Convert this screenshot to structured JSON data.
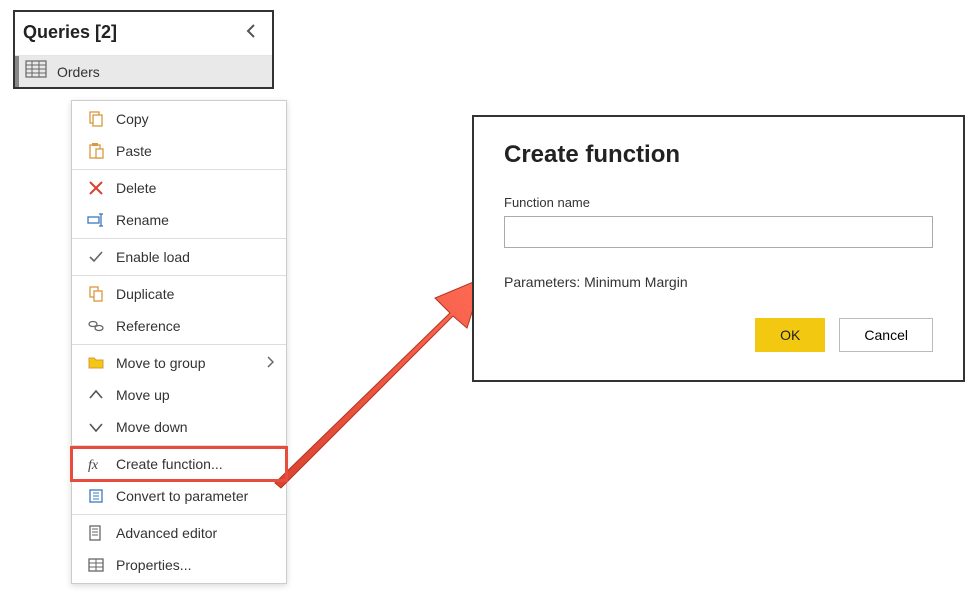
{
  "queries": {
    "title": "Queries [2]",
    "selected_query": "Orders"
  },
  "menu": {
    "copy": "Copy",
    "paste": "Paste",
    "delete": "Delete",
    "rename": "Rename",
    "enable_load": "Enable load",
    "duplicate": "Duplicate",
    "reference": "Reference",
    "move_to_group": "Move to group",
    "move_up": "Move up",
    "move_down": "Move down",
    "create_function": "Create function...",
    "convert_to_parameter": "Convert to parameter",
    "advanced_editor": "Advanced editor",
    "properties": "Properties..."
  },
  "dialog": {
    "title": "Create function",
    "fn_name_label": "Function name",
    "fn_name_value": "",
    "params_text": "Parameters: Minimum Margin",
    "ok": "OK",
    "cancel": "Cancel"
  }
}
